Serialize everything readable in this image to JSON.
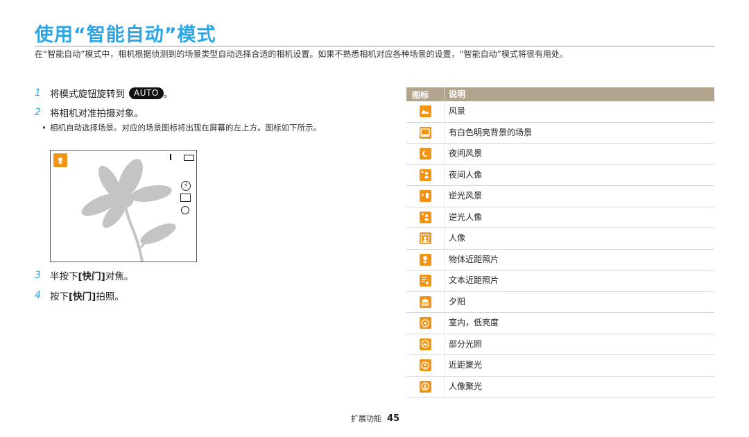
{
  "title": "使用“智能自动”模式",
  "intro": "在“智能自动”模式中，相机根据侦测到的场景类型自动选择合适的相机设置。如果不熟悉相机对应各种场景的设置，“智能自动”模式将很有用处。",
  "steps": [
    {
      "num": "1",
      "text": "将模式旋钮旋转到",
      "badge": "AUTO",
      "suffix": "。"
    },
    {
      "num": "2",
      "text": "将相机对准拍摄对象。"
    },
    {
      "num": "3",
      "pre": "半按下 ",
      "bold": "[快门]",
      "post": " 对焦。"
    },
    {
      "num": "4",
      "pre": "按下 ",
      "bold": "[快门]",
      "post": " 拍照。"
    }
  ],
  "bullet": {
    "dot": "•",
    "text": "相机自动选择场景。对应的场景图标将出现在屏幕的左上方。图标如下所示。"
  },
  "table": {
    "header_icon": "图标",
    "header_desc": "说明",
    "rows": [
      {
        "icon": "landscape-icon",
        "desc": "风景"
      },
      {
        "icon": "white-background-icon",
        "desc": "有白色明亮背景的场景"
      },
      {
        "icon": "night-landscape-icon",
        "desc": "夜间风景"
      },
      {
        "icon": "night-portrait-icon",
        "desc": "夜间人像"
      },
      {
        "icon": "backlit-landscape-icon",
        "desc": "逆光风景"
      },
      {
        "icon": "backlit-portrait-icon",
        "desc": "逆光人像"
      },
      {
        "icon": "portrait-icon",
        "desc": "人像"
      },
      {
        "icon": "object-macro-icon",
        "desc": "物体近距照片"
      },
      {
        "icon": "text-macro-icon",
        "desc": "文本近距照片"
      },
      {
        "icon": "sunset-icon",
        "desc": "夕阳"
      },
      {
        "icon": "indoor-low-light-icon",
        "desc": "室内，低亮度"
      },
      {
        "icon": "partial-light-icon",
        "desc": "部分光照"
      },
      {
        "icon": "close-spotlight-icon",
        "desc": "近距聚光"
      },
      {
        "icon": "portrait-spotlight-icon",
        "desc": "人像聚光"
      }
    ]
  },
  "colors": {
    "title": "#2aa6e6",
    "step_num": "#2aa6e6",
    "header_bg": "#b3a48d",
    "icon_bg": "#f29312"
  },
  "footer": {
    "section": "扩展功能",
    "page": "45"
  }
}
